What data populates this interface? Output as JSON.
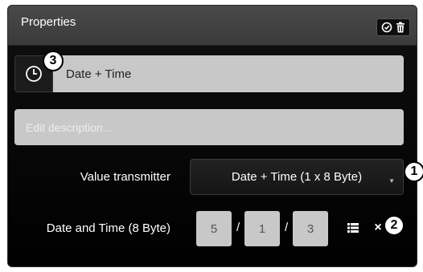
{
  "panel": {
    "title": "Properties",
    "tools": [
      {
        "icon": "check-circle-icon"
      },
      {
        "icon": "trash-icon"
      }
    ]
  },
  "name_field": {
    "icon": "clock-icon",
    "value": "Date + Time"
  },
  "description_field": {
    "placeholder": "Edit description...",
    "value": ""
  },
  "value_transmitter": {
    "label": "Value transmitter",
    "selected": "Date + Time (1 x 8 Byte)",
    "arrow_icon": "dropdown-arrow-icon"
  },
  "date_time": {
    "label": "Date and Time (8 Byte)",
    "fields": [
      "5",
      "1",
      "3"
    ],
    "separators": [
      "/",
      "/"
    ],
    "list_icon": "list-icon",
    "clear_label": "×"
  },
  "callouts": [
    "1",
    "2",
    "3"
  ],
  "colors": {
    "panel_bg": "#000000",
    "header_bg": "#444444",
    "field_bg": "#c8c8c8",
    "text": "#ffffff"
  }
}
